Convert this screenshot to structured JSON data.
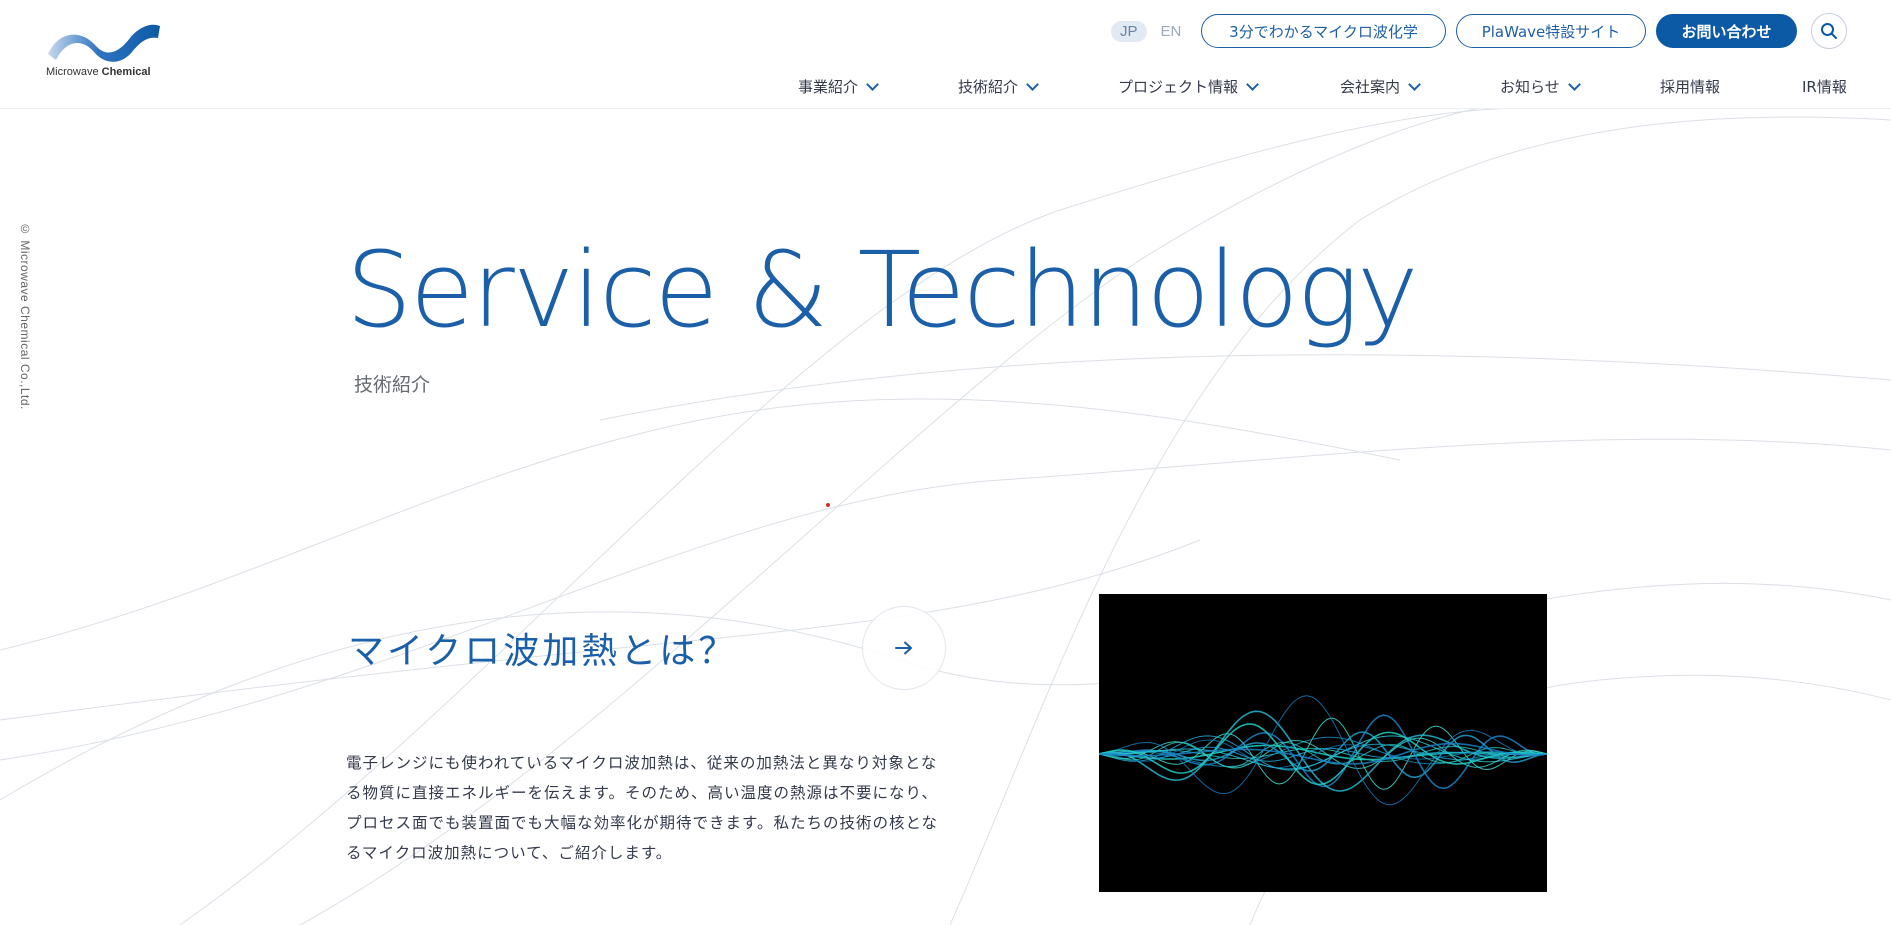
{
  "logo": {
    "text_plain": "Microwave",
    "text_bold": "Chemical"
  },
  "header": {
    "lang": {
      "jp": "JP",
      "en": "EN"
    },
    "buttons": {
      "learn": "3分でわかるマイクロ波化学",
      "plawave": "PlaWave特設サイト",
      "contact": "お問い合わせ"
    },
    "search_icon": "search-icon"
  },
  "nav": [
    {
      "label": "事業紹介",
      "has_dropdown": true
    },
    {
      "label": "技術紹介",
      "has_dropdown": true
    },
    {
      "label": "プロジェクト情報",
      "has_dropdown": true
    },
    {
      "label": "会社案内",
      "has_dropdown": true
    },
    {
      "label": "お知らせ",
      "has_dropdown": true
    },
    {
      "label": "採用情報",
      "has_dropdown": false
    },
    {
      "label": "IR情報",
      "has_dropdown": false
    }
  ],
  "copyright": "© Microwave Chemical Co.,Ltd.",
  "hero": {
    "title": "Service & Technology",
    "subtitle": "技術紹介"
  },
  "section": {
    "title": "マイクロ波加熱とは？",
    "arrow_icon": "arrow-right-icon",
    "body": "電子レンジにも使われているマイクロ波加熱は、従来の加熱法と異なり対象となる物質に直接エネルギーを伝えます。そのため、高い温度の熱源は不要になり、プロセス面でも装置面でも大幅な効率化が期待できます。私たちの技術の核となるマイクロ波加熱について、ご紹介します。",
    "image": "microwave-waveform-image"
  },
  "colors": {
    "brand_blue": "#1b5fa8",
    "button_blue": "#0c5aa6",
    "text": "#333a4a",
    "image_bg": "#000000",
    "wave": "#1fd1c5"
  }
}
